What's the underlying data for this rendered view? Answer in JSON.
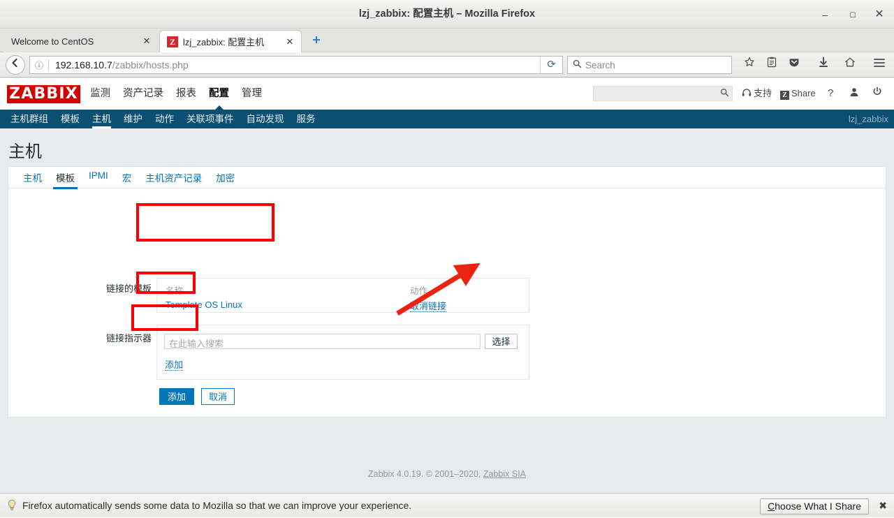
{
  "browser": {
    "window_title": "lzj_zabbix: 配置主机 – Mozilla Firefox",
    "minimize": "–",
    "maximize": "❐",
    "close": "✕",
    "tabs": [
      {
        "label": "Welcome to CentOS",
        "close": "✕",
        "favicon": ""
      },
      {
        "label": "lzj_zabbix: 配置主机",
        "close": "✕",
        "favicon": "Z"
      }
    ],
    "new_tab": "✛",
    "back": "←",
    "identity_icon": "ⓘ",
    "url_host": "192.168.10.7",
    "url_path": "/zabbix/hosts.php",
    "reload": "⟳",
    "search_placeholder": "Search",
    "search_icon": "🔍",
    "toolbar_icons": {
      "bookmark": "☆",
      "library": "▤",
      "pocket": "▼",
      "downloads": "⬇",
      "home": "⌂",
      "menu": "☰"
    }
  },
  "zabbix": {
    "logo": "ZABBIX",
    "main_menu": [
      {
        "label": "监测",
        "selected": false
      },
      {
        "label": "资产记录",
        "selected": false
      },
      {
        "label": "报表",
        "selected": false
      },
      {
        "label": "配置",
        "selected": true
      },
      {
        "label": "管理",
        "selected": false
      }
    ],
    "header_search_value": "",
    "header_search_icon": "search-icon",
    "support_label": "支持",
    "share_label": "Share",
    "share_badge": "Z",
    "help_label": "?",
    "user_icon": "user-icon",
    "signout_icon": "power-icon",
    "sub_menu": [
      {
        "label": "主机群组",
        "selected": false
      },
      {
        "label": "模板",
        "selected": false
      },
      {
        "label": "主机",
        "selected": true
      },
      {
        "label": "维护",
        "selected": false
      },
      {
        "label": "动作",
        "selected": false
      },
      {
        "label": "关联项事件",
        "selected": false
      },
      {
        "label": "自动发现",
        "selected": false
      },
      {
        "label": "服务",
        "selected": false
      }
    ],
    "logged_in_user": "lzj_zabbix",
    "page_title": "主机",
    "form_tabs": [
      {
        "label": "主机",
        "selected": false
      },
      {
        "label": "模板",
        "selected": true
      },
      {
        "label": "IPMI",
        "selected": false
      },
      {
        "label": "宏",
        "selected": false
      },
      {
        "label": "主机资产记录",
        "selected": false
      },
      {
        "label": "加密",
        "selected": false
      }
    ],
    "form": {
      "linked_templates_label": "链接的模板",
      "table_headers": {
        "name": "名称",
        "action": "动作"
      },
      "rows": [
        {
          "name": "Template OS Linux",
          "action": "取消链接"
        }
      ],
      "link_indicator_label": "链接指示器",
      "search_placeholder": "在此输入搜索",
      "select_button": "选择",
      "add_link": "添加",
      "submit_button": "添加",
      "cancel_button": "取消"
    },
    "footer": {
      "text": "Zabbix 4.0.19. © 2001–2020, ",
      "link": "Zabbix SIA"
    }
  },
  "notification": {
    "icon": "lightbulb-icon",
    "message": "Firefox automatically sends some data to Mozilla so that we can improve your experience.",
    "button_first": "C",
    "button_rest": "hoose What I Share",
    "close": "✖"
  },
  "annotations": {
    "accent_red": "#ff0000",
    "zabbix_blue": "#0275b8",
    "zabbix_header_blue": "#0b4f73",
    "zabbix_logo_red": "#d40000"
  }
}
